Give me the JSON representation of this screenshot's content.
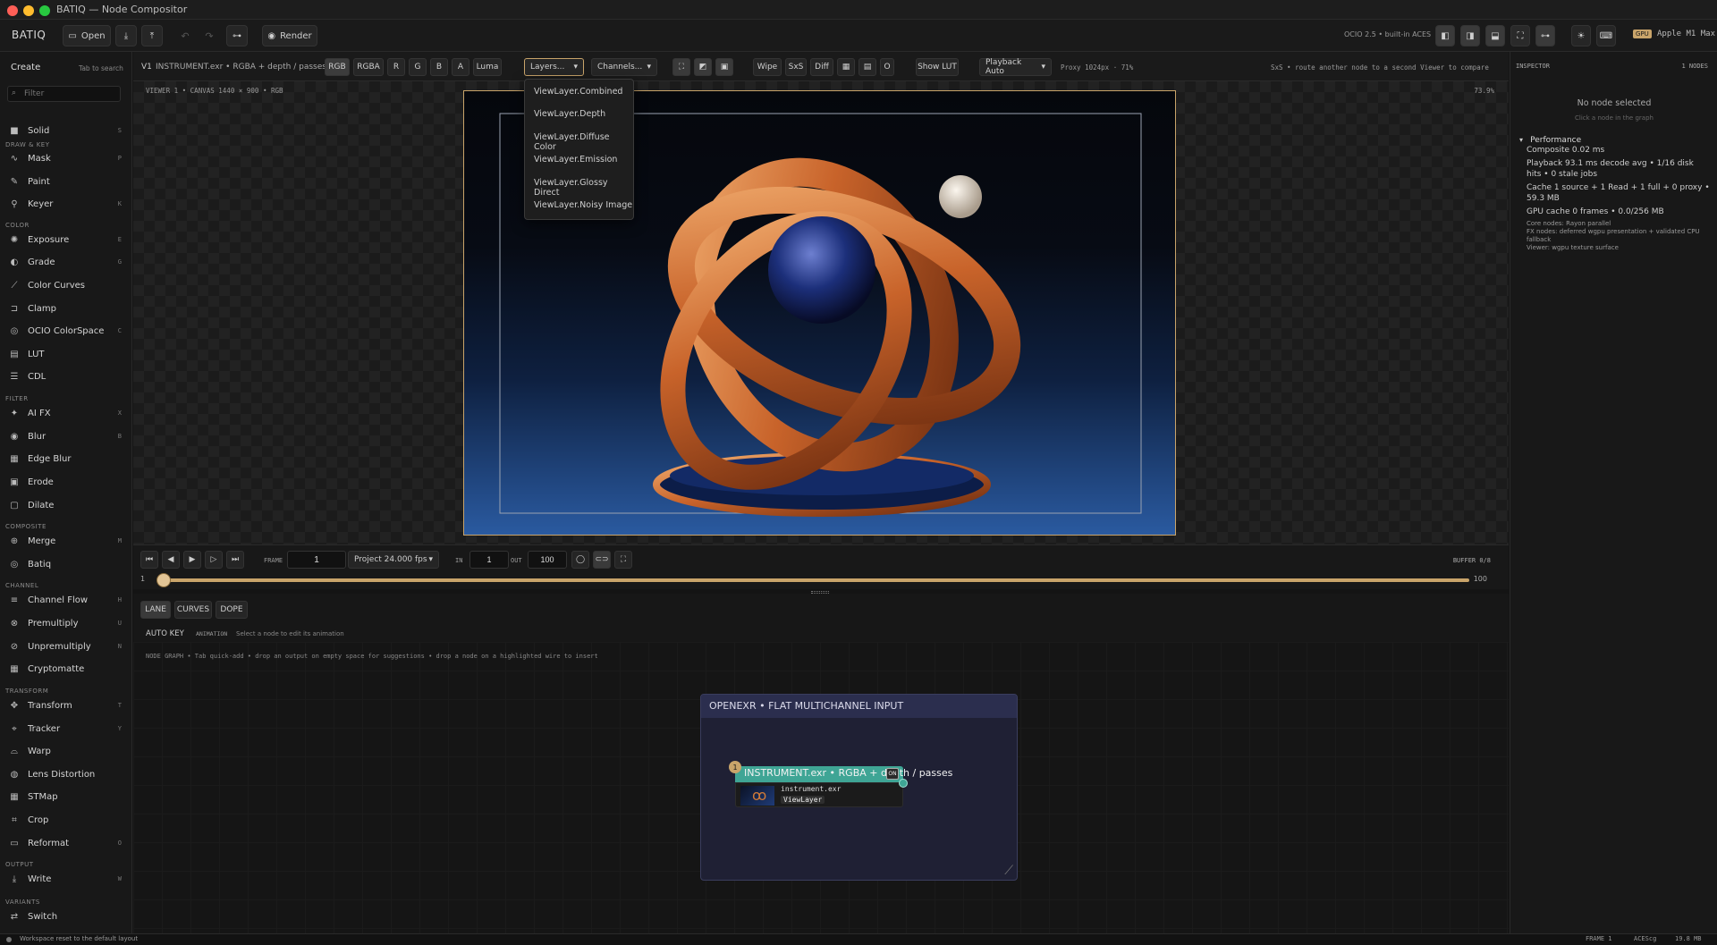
{
  "window": {
    "title": "BATIQ — Node Compositor"
  },
  "toolbar": {
    "brand": "BATIQ",
    "open_label": "Open",
    "render_label": "Render",
    "ocio_text": "OCIO 2.5 • built-in ACES",
    "gpu_badge": "GPU",
    "gpu_name": "Apple M1 Max"
  },
  "sidebar": {
    "title": "Create",
    "hint": "Tab to search",
    "filter_placeholder": "Filter",
    "sections": {
      "draw": "DRAW & KEY",
      "color": "COLOR",
      "filter": "FILTER",
      "composite": "COMPOSITE",
      "channel": "CHANNEL",
      "transform": "TRANSFORM",
      "output": "OUTPUT",
      "variants": "VARIANTS"
    },
    "items": {
      "solid": {
        "label": "Solid",
        "key": "S"
      },
      "mask": {
        "label": "Mask",
        "key": "P"
      },
      "paint": {
        "label": "Paint",
        "key": ""
      },
      "keyer": {
        "label": "Keyer",
        "key": "K"
      },
      "exposure": {
        "label": "Exposure",
        "key": "E"
      },
      "grade": {
        "label": "Grade",
        "key": "G"
      },
      "colorcurves": {
        "label": "Color Curves",
        "key": ""
      },
      "clamp": {
        "label": "Clamp",
        "key": ""
      },
      "ocio": {
        "label": "OCIO ColorSpace",
        "key": "C"
      },
      "lut": {
        "label": "LUT",
        "key": ""
      },
      "cdl": {
        "label": "CDL",
        "key": ""
      },
      "aifx": {
        "label": "AI FX",
        "key": "X"
      },
      "blur": {
        "label": "Blur",
        "key": "B"
      },
      "edgeblur": {
        "label": "Edge Blur",
        "key": ""
      },
      "erode": {
        "label": "Erode",
        "key": ""
      },
      "dilate": {
        "label": "Dilate",
        "key": ""
      },
      "merge": {
        "label": "Merge",
        "key": "M"
      },
      "batiq": {
        "label": "Batiq",
        "key": ""
      },
      "channelflow": {
        "label": "Channel Flow",
        "key": "H"
      },
      "premultiply": {
        "label": "Premultiply",
        "key": "U"
      },
      "unpremultiply": {
        "label": "Unpremultiply",
        "key": "N"
      },
      "cryptomatte": {
        "label": "Cryptomatte",
        "key": ""
      },
      "transform": {
        "label": "Transform",
        "key": "T"
      },
      "tracker": {
        "label": "Tracker",
        "key": "Y"
      },
      "warp": {
        "label": "Warp",
        "key": ""
      },
      "lens": {
        "label": "Lens Distortion",
        "key": ""
      },
      "stmap": {
        "label": "STMap",
        "key": ""
      },
      "crop": {
        "label": "Crop",
        "key": ""
      },
      "reformat": {
        "label": "Reformat",
        "key": "O"
      },
      "write": {
        "label": "Write",
        "key": "W"
      },
      "switch": {
        "label": "Switch",
        "key": ""
      }
    }
  },
  "viewer_header": {
    "viewer_label": "V1",
    "source": "INSTRUMENT.exr • RGBA + depth / passes",
    "channels_btns": [
      "RGB",
      "RGBA",
      "R",
      "G",
      "B",
      "A",
      "Luma"
    ],
    "layers_label": "Layers...",
    "channels_label": "Channels...",
    "wipe": "Wipe",
    "sxs": "SxS",
    "diff": "Diff",
    "o": "O",
    "show_lut": "Show LUT",
    "playback": "Playback Auto",
    "proxy": "Proxy 1024px · 71%",
    "hint": "SxS  •  route another node to a second Viewer to compare"
  },
  "layers_menu": [
    "ViewLayer.Combined",
    "ViewLayer.Depth",
    "ViewLayer.Diffuse Color",
    "ViewLayer.Emission",
    "ViewLayer.Glossy Direct",
    "ViewLayer.Noisy Image"
  ],
  "viewer": {
    "info": "VIEWER 1  •  CANVAS 1440 × 900  •  RGB",
    "zoom": "73.9%"
  },
  "transport": {
    "frame_label": "FRAME",
    "frame": "1",
    "project_fps": "Project 24.000 fps",
    "in_label": "IN",
    "in_value": "1",
    "out_label": "OUT",
    "out_value": "100",
    "buffer": "BUFFER  0/8",
    "timeline_start": "1",
    "timeline_end": "100",
    "playhead_fraction": 0.0
  },
  "lane": {
    "tabs": [
      "LANE",
      "CURVES",
      "DOPE"
    ],
    "auto_key": "AUTO KEY",
    "animation_label": "ANIMATION",
    "animation_hint": "Select a node to edit its animation"
  },
  "graph": {
    "hint": "NODE GRAPH  •  Tab quick-add  •  drop an output on empty space for suggestions  •  drop a node on a highlighted wire to insert",
    "backdrop_title": "OPENEXR • FLAT MULTICHANNEL INPUT",
    "node": {
      "badge": "1",
      "title": "INSTRUMENT.exr • RGBA + depth / passes",
      "on_badge": "ON",
      "filename": "instrument.exr",
      "tag": "ViewLayer"
    }
  },
  "inspector": {
    "title": "INSPECTOR",
    "count": "1 NODES",
    "empty_title": "No node selected",
    "empty_hint": "Click a node in the graph",
    "perf_title": "Performance",
    "composite": "Composite  0.02 ms",
    "playback": "Playback  93.1 ms decode avg  •  1/16 disk hits  •  0 stale jobs",
    "cache": "Cache  1 source + 1 Read + 1 full + 0 proxy  •  59.3 MB",
    "gpu_cache": "GPU cache  0 frames  •  0.0/256 MB",
    "core": "Core nodes: Rayon parallel",
    "fx": "FX nodes: deferred wgpu presentation + validated CPU fallback",
    "viewer": "Viewer: wgpu texture surface"
  },
  "status": {
    "message": "Workspace reset to the default layout",
    "frame": "FRAME 1",
    "colorspace": "ACEScg",
    "memory": "19.8 MB"
  },
  "colors": {
    "accent": "#c9a46a",
    "node_teal": "#3fa595",
    "backdrop": "#22243a"
  }
}
